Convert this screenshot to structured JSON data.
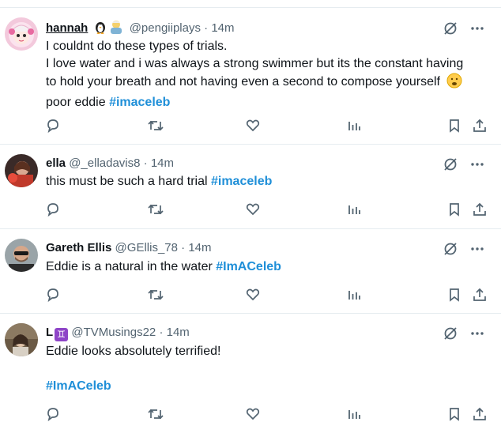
{
  "tweets": [
    {
      "name": "hannah",
      "name_emojis": [
        "penguin",
        "older-person"
      ],
      "handle": "@pengiiplays",
      "separator": "·",
      "time": "14m",
      "lines": [
        "I couldnt do these types of trials.",
        "I love water and i was always a strong swimmer but its the constant having",
        "to hold your breath and not having even a second to compose yourself"
      ],
      "last_line_prefix": "poor eddie ",
      "hashtag": "#imaceleb",
      "emoji": "worried-face"
    },
    {
      "name": "ella",
      "handle": "@_elladavis8",
      "separator": "·",
      "time": "14m",
      "text": "this must be such a hard trial ",
      "hashtag": "#imaceleb"
    },
    {
      "name": "Gareth Ellis",
      "handle": "@GEllis_78",
      "separator": "·",
      "time": "14m",
      "text": "Eddie is a natural in the water ",
      "hashtag": "#ImACeleb"
    },
    {
      "name": "L",
      "name_badge": "♊",
      "handle": "@TVMusings22",
      "separator": "·",
      "time": "14m",
      "text": "Eddie looks absolutely terrified!",
      "hashtag": "#ImACeleb"
    }
  ],
  "icons": {
    "top": [
      "grok-slash-icon",
      "more-icon"
    ],
    "actions": [
      "reply-icon",
      "retweet-icon",
      "like-icon",
      "views-icon",
      "bookmark-icon",
      "share-icon"
    ]
  },
  "colors": {
    "hashtag": "#1f8fd8",
    "secondary_text": "#536471",
    "divider": "#e6ecf0",
    "icon": "#536471"
  }
}
